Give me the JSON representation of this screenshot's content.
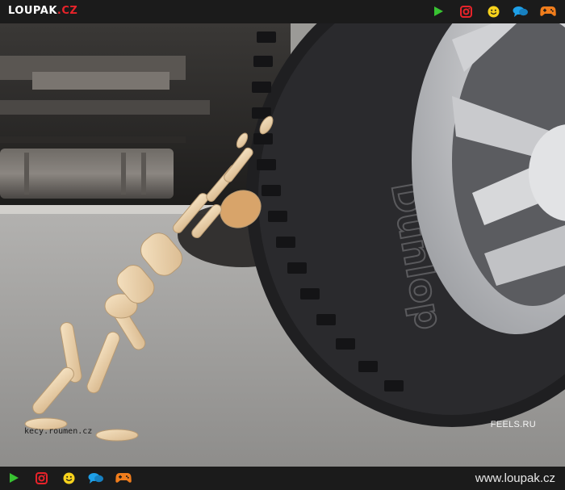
{
  "header": {
    "logo_main": "LOUPAK",
    "logo_accent": ".CZ",
    "icons": [
      "play-icon",
      "instagram-icon",
      "smiley-icon",
      "chat-icon",
      "gamepad-icon"
    ]
  },
  "photo": {
    "watermark_left": "kecy.roumen.cz",
    "watermark_right": "FEELS.RU",
    "tire_text": "Dunlop"
  },
  "footer": {
    "url": "www.loupak.cz",
    "icons": [
      "play-icon",
      "instagram-icon",
      "smiley-icon",
      "chat-icon",
      "gamepad-icon"
    ]
  },
  "colors": {
    "bar": "#1b1b1b",
    "play": "#38c332",
    "instagram": "#e8232a",
    "smiley": "#f7d21c",
    "chat": "#1ea0e8",
    "gamepad": "#f07d1c",
    "logo_accent": "#e8232a"
  }
}
